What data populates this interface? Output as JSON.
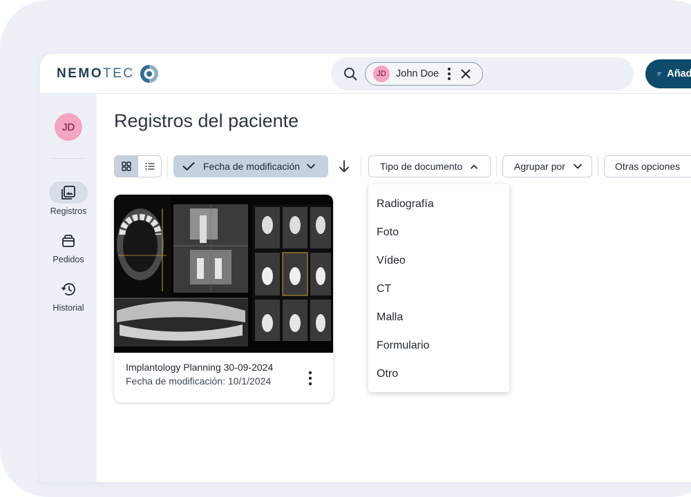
{
  "brand": {
    "name_bold": "NEMO",
    "name_light": "TEC"
  },
  "search": {
    "patient_initials": "JD",
    "patient_name": "John Doe"
  },
  "header": {
    "add_patient_label": "Añadir paciente"
  },
  "sidebar": {
    "avatar_initials": "JD",
    "items": [
      {
        "label": "Registros",
        "icon": "records-icon",
        "active": true
      },
      {
        "label": "Pedidos",
        "icon": "orders-icon",
        "active": false
      },
      {
        "label": "Historial",
        "icon": "history-icon",
        "active": false
      }
    ]
  },
  "main": {
    "title": "Registros del paciente",
    "toolbar": {
      "view_modes": [
        "grid-view",
        "list-view"
      ],
      "active_view": "grid-view",
      "sort_label": "Fecha de modificación",
      "doc_type_label": "Tipo de documento",
      "group_label": "Agrupar por",
      "more_label": "Otras opciones"
    },
    "cards": [
      {
        "title": "Implantology Planning 30-09-2024",
        "modified": "Fecha de modificación: 10/1/2024"
      }
    ]
  },
  "doc_type_menu": {
    "options": [
      "Radiografía",
      "Foto",
      "Vídeo",
      "CT",
      "Malla",
      "Formulario",
      "Otro"
    ]
  },
  "colors": {
    "primary": "#0d4a6b",
    "avatar": "#f4a5c1",
    "selected": "#c4d2df",
    "background": "#edf0f7"
  }
}
